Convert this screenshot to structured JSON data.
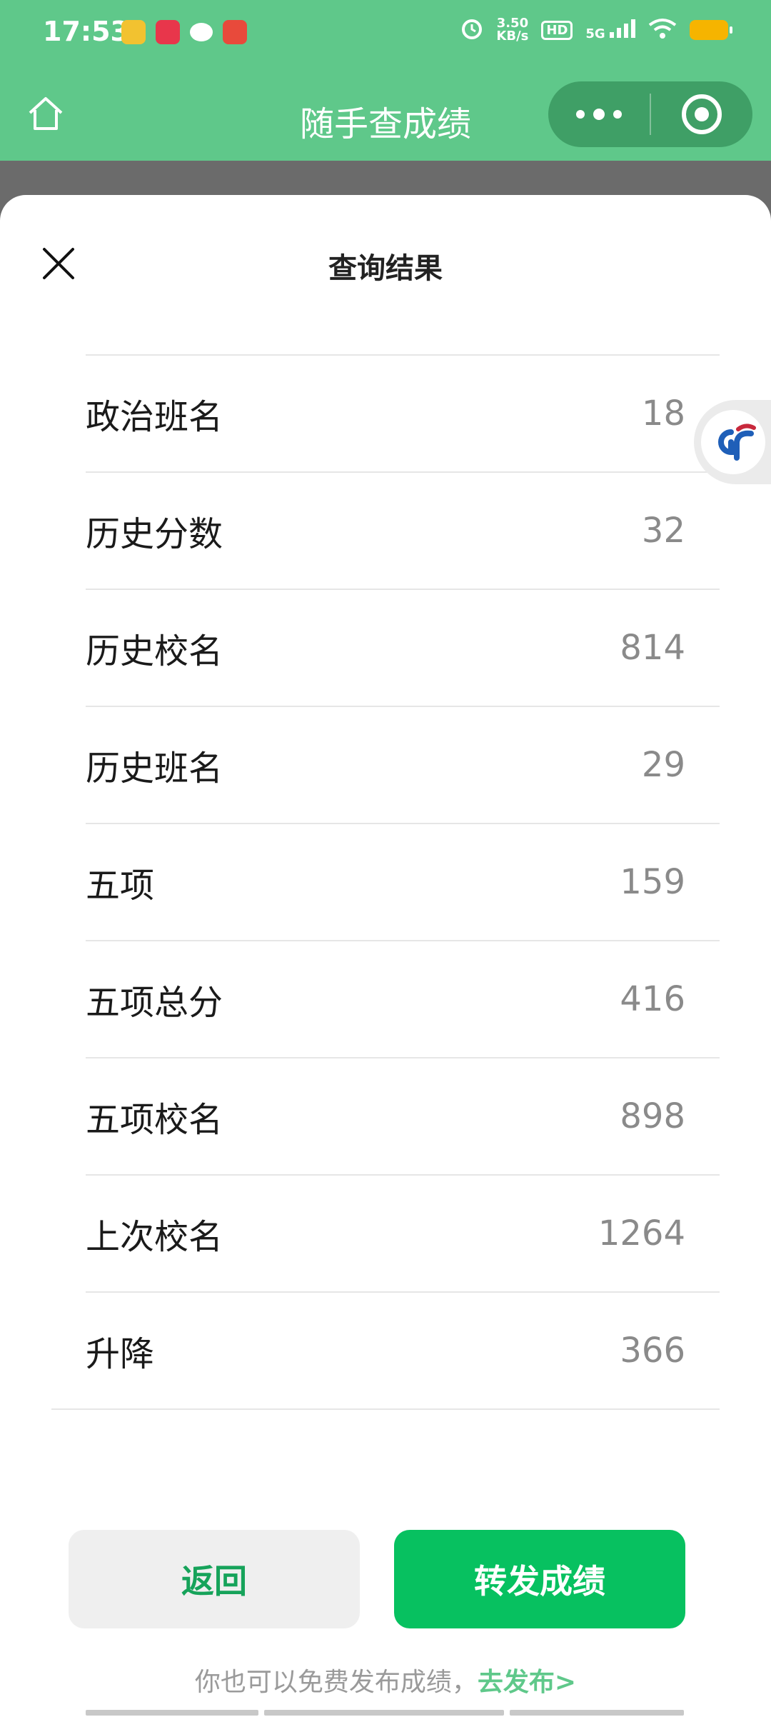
{
  "status_bar": {
    "time": "17:53",
    "speed_value": "3.50",
    "speed_unit": "KB/s",
    "hd_badge": "HD",
    "network": "5G"
  },
  "nav": {
    "title": "随手查成绩"
  },
  "sheet": {
    "title": "查询结果",
    "rows": [
      {
        "label": "政治班名",
        "value": "18"
      },
      {
        "label": "历史分数",
        "value": "32"
      },
      {
        "label": "历史校名",
        "value": "814"
      },
      {
        "label": "历史班名",
        "value": "29"
      },
      {
        "label": "五项",
        "value": "159"
      },
      {
        "label": "五项总分",
        "value": "416"
      },
      {
        "label": "五项校名",
        "value": "898"
      },
      {
        "label": "上次校名",
        "value": "1264"
      },
      {
        "label": "升降",
        "value": "366"
      }
    ]
  },
  "actions": {
    "back_label": "返回",
    "forward_label": "转发成绩"
  },
  "footer": {
    "note": "你也可以免费发布成绩，",
    "link": "去发布>"
  },
  "colors": {
    "header_green": "#5fc88a",
    "primary_green": "#07c160",
    "battery": "#f6b400"
  },
  "icons": [
    "home-icon",
    "more-icon",
    "close-mini-program-icon",
    "close-icon",
    "floating-assistant-icon"
  ]
}
